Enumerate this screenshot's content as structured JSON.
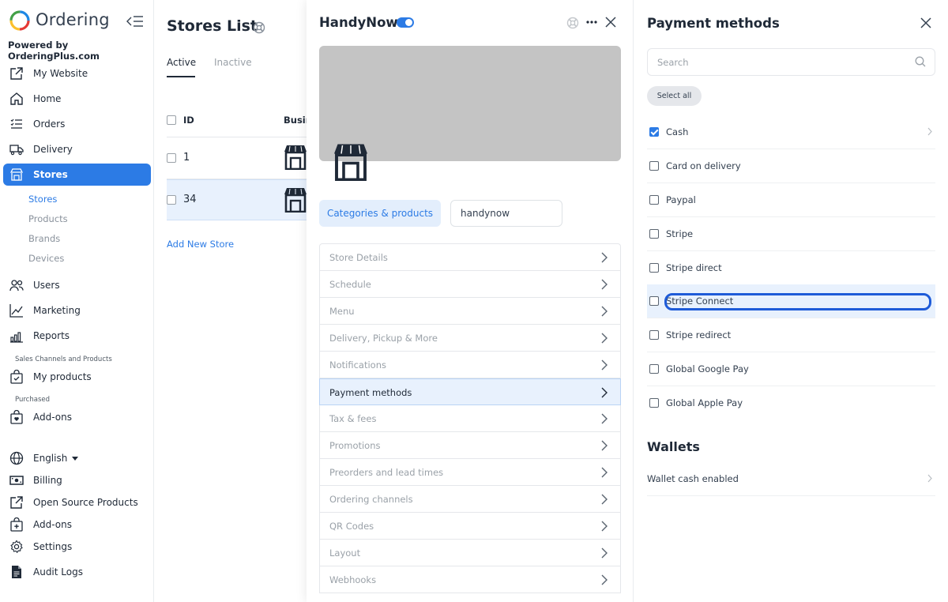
{
  "brand": {
    "name": "Ordering",
    "powered_by": "Powered by OrderingPlus.com"
  },
  "sidebar": {
    "items": [
      {
        "label": "My Website",
        "icon": "external-link-icon"
      },
      {
        "label": "Home",
        "icon": "home-icon"
      },
      {
        "label": "Orders",
        "icon": "list-icon"
      },
      {
        "label": "Delivery",
        "icon": "truck-icon"
      },
      {
        "label": "Stores",
        "icon": "shop-icon",
        "active": true
      },
      {
        "label": "Users",
        "icon": "users-icon"
      },
      {
        "label": "Marketing",
        "icon": "graph-icon"
      },
      {
        "label": "Reports",
        "icon": "bar-chart-icon"
      },
      {
        "label": "My products",
        "icon": "check-bag-icon"
      },
      {
        "label": "Add-ons",
        "icon": "bag-heart-icon"
      },
      {
        "label": "English",
        "icon": "globe-icon"
      },
      {
        "label": "Billing",
        "icon": "cash-icon"
      },
      {
        "label": "Open Source Products",
        "icon": "external-link-icon"
      },
      {
        "label": "Add-ons",
        "icon": "bag-plus-icon"
      },
      {
        "label": "Settings",
        "icon": "gear-icon"
      },
      {
        "label": "Audit Logs",
        "icon": "file-icon"
      }
    ],
    "stores_sub": [
      "Stores",
      "Products",
      "Brands",
      "Devices"
    ],
    "section_sales": "Sales Channels and Products",
    "section_purchased": "Purchased"
  },
  "stores_list": {
    "title": "Stores List",
    "tabs": [
      "Active",
      "Inactive"
    ],
    "columns": {
      "id": "ID",
      "business": "Busin"
    },
    "rows": [
      {
        "id": "1"
      },
      {
        "id": "34"
      }
    ],
    "add_new": "Add New Store"
  },
  "store_detail": {
    "name": "HandyNow",
    "categories_button": "Categories & products",
    "slug": "handynow",
    "menu": [
      "Store Details",
      "Schedule",
      "Menu",
      "Delivery, Pickup & More",
      "Notifications",
      "Payment methods",
      "Tax & fees",
      "Promotions",
      "Preorders and lead times",
      "Ordering channels",
      "QR Codes",
      "Layout",
      "Webhooks"
    ],
    "active_menu": "Payment methods"
  },
  "payment_methods": {
    "title": "Payment methods",
    "search_placeholder": "Search",
    "select_all": "Select all",
    "methods": [
      {
        "label": "Cash",
        "checked": true
      },
      {
        "label": "Card on delivery",
        "checked": false
      },
      {
        "label": "Paypal",
        "checked": false
      },
      {
        "label": "Stripe",
        "checked": false
      },
      {
        "label": "Stripe direct",
        "checked": false
      },
      {
        "label": "Stripe Connect",
        "checked": false
      },
      {
        "label": "Stripe redirect",
        "checked": false
      },
      {
        "label": "Global Google Pay",
        "checked": false
      },
      {
        "label": "Global Apple Pay",
        "checked": false
      }
    ],
    "wallets_title": "Wallets",
    "wallet_item": "Wallet cash enabled"
  },
  "colors": {
    "accent": "#2c7be5",
    "highlight": "#e8f1fd",
    "text": "#344050"
  }
}
